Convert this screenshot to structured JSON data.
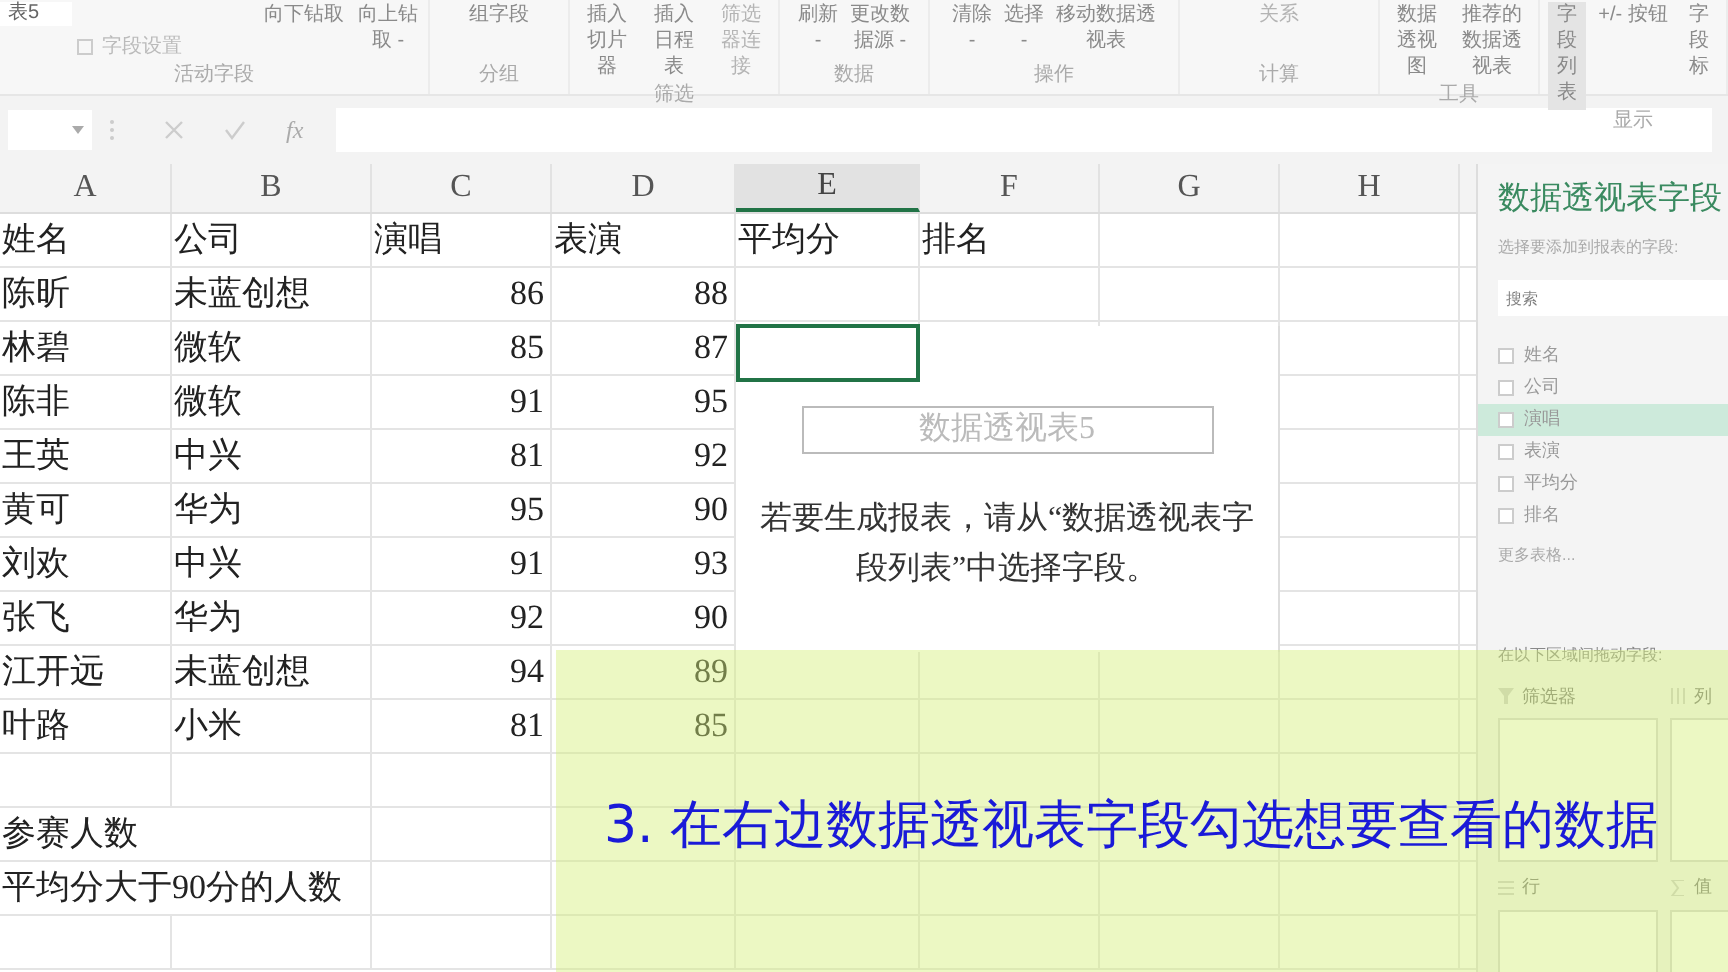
{
  "ribbon": {
    "pivot_name": "表5",
    "field_settings": "字段设置",
    "groups": [
      {
        "label": "活动字段",
        "buttons": [
          {
            "label": "向下钻取",
            "disabled": false,
            "selected": false
          },
          {
            "label": "向上钻取 -",
            "disabled": false,
            "selected": false
          }
        ]
      },
      {
        "label": "分组",
        "buttons": [
          {
            "label": "组字段",
            "disabled": false,
            "selected": false
          }
        ]
      },
      {
        "label": "筛选",
        "buttons": [
          {
            "label": "插入切片器",
            "disabled": false,
            "selected": false
          },
          {
            "label": "插入日程表",
            "disabled": false,
            "selected": false
          },
          {
            "label": "筛选器连接",
            "disabled": true,
            "selected": false
          }
        ]
      },
      {
        "label": "数据",
        "buttons": [
          {
            "label": "刷新 -",
            "disabled": false,
            "selected": false
          },
          {
            "label": "更改数据源 -",
            "disabled": false,
            "selected": false
          }
        ]
      },
      {
        "label": "操作",
        "buttons": [
          {
            "label": "清除 -",
            "disabled": false,
            "selected": false
          },
          {
            "label": "选择 -",
            "disabled": false,
            "selected": false
          },
          {
            "label": "移动数据透视表",
            "disabled": false,
            "selected": false
          }
        ]
      },
      {
        "label": "计算",
        "buttons": [
          {
            "label": "关系",
            "disabled": true,
            "selected": false
          }
        ]
      },
      {
        "label": "工具",
        "buttons": [
          {
            "label": "数据透视图",
            "disabled": false,
            "selected": false
          },
          {
            "label": "推荐的数据透视表",
            "disabled": false,
            "selected": false
          }
        ]
      },
      {
        "label": "显示",
        "buttons": [
          {
            "label": "字段列表",
            "disabled": false,
            "selected": true
          },
          {
            "label": "+/- 按钮",
            "disabled": false,
            "selected": false
          },
          {
            "label": "字段标",
            "disabled": false,
            "selected": false
          }
        ]
      }
    ]
  },
  "formula_bar": {
    "function_label": "fx"
  },
  "sheet": {
    "columns": [
      {
        "label": "A",
        "selected": false
      },
      {
        "label": "B",
        "selected": false
      },
      {
        "label": "C",
        "selected": false
      },
      {
        "label": "D",
        "selected": false
      },
      {
        "label": "E",
        "selected": true
      },
      {
        "label": "F",
        "selected": false
      },
      {
        "label": "G",
        "selected": false
      },
      {
        "label": "H",
        "selected": false
      }
    ],
    "rows": [
      [
        "姓名",
        "公司",
        "演唱",
        "表演",
        "平均分",
        "排名"
      ],
      [
        "陈昕",
        "未蓝创想",
        "86",
        "88"
      ],
      [
        "林碧",
        "微软",
        "85",
        "87"
      ],
      [
        "陈非",
        "微软",
        "91",
        "95"
      ],
      [
        "王英",
        "中兴",
        "81",
        "92"
      ],
      [
        "黄可",
        "华为",
        "95",
        "90"
      ],
      [
        "刘欢",
        "中兴",
        "91",
        "93"
      ],
      [
        "张飞",
        "华为",
        "92",
        "90"
      ],
      [
        "江开远",
        "未蓝创想",
        "94",
        "89"
      ],
      [
        "叶路",
        "小米",
        "81",
        "85"
      ],
      [],
      [
        "参赛人数"
      ],
      [
        "平均分大于90分的人数"
      ],
      []
    ],
    "pivot_placeholder": {
      "name": "数据透视表5",
      "message": "若要生成报表，请从“数据透视表字段列表”中选择字段。"
    }
  },
  "field_pane": {
    "title": "数据透视表字段",
    "prompt": "选择要添加到报表的字段:",
    "search_placeholder": "搜索",
    "fields": [
      {
        "label": "姓名",
        "checked": false,
        "selected": false
      },
      {
        "label": "公司",
        "checked": false,
        "selected": false
      },
      {
        "label": "演唱",
        "checked": false,
        "selected": true
      },
      {
        "label": "表演",
        "checked": false,
        "selected": false
      },
      {
        "label": "平均分",
        "checked": false,
        "selected": false
      },
      {
        "label": "排名",
        "checked": false,
        "selected": false
      }
    ],
    "more_tables": "更多表格...",
    "areas_prompt": "在以下区域间拖动字段:",
    "areas": [
      {
        "kind": "filter",
        "label": "筛选器"
      },
      {
        "kind": "columns",
        "label": "列"
      },
      {
        "kind": "rows",
        "label": "行"
      },
      {
        "kind": "values",
        "label": "值"
      }
    ]
  },
  "caption": "3. 在右边数据透视表字段勾选想要查看的数据"
}
